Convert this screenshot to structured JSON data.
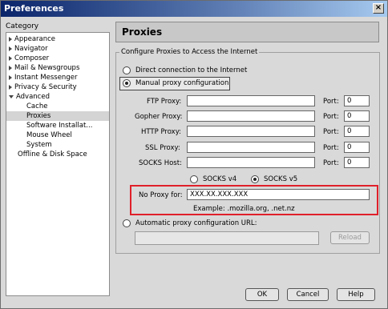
{
  "window": {
    "title": "Preferences",
    "close_glyph": "×"
  },
  "sidebar": {
    "label": "Category",
    "items": [
      {
        "label": "Appearance",
        "expander": "right"
      },
      {
        "label": "Navigator",
        "expander": "right"
      },
      {
        "label": "Composer",
        "expander": "right"
      },
      {
        "label": "Mail & Newsgroups",
        "expander": "right"
      },
      {
        "label": "Instant Messenger",
        "expander": "right"
      },
      {
        "label": "Privacy & Security",
        "expander": "right"
      },
      {
        "label": "Advanced",
        "expander": "down"
      },
      {
        "label": "Cache",
        "expander": ""
      },
      {
        "label": "Proxies",
        "expander": "",
        "selected": true
      },
      {
        "label": "Software Installat...",
        "expander": ""
      },
      {
        "label": "Mouse Wheel",
        "expander": ""
      },
      {
        "label": "System",
        "expander": ""
      },
      {
        "label": "Offline & Disk Space",
        "expander": ""
      }
    ]
  },
  "panel": {
    "title": "Proxies",
    "group_label": "Configure Proxies to Access the Internet",
    "direct_label": "Direct connection to the Internet",
    "manual_label": "Manual proxy configuration",
    "port_label": "Port:",
    "proxies": [
      {
        "label": "FTP Proxy:",
        "host": "",
        "port": "0"
      },
      {
        "label": "Gopher Proxy:",
        "host": "",
        "port": "0"
      },
      {
        "label": "HTTP Proxy:",
        "host": "",
        "port": "0"
      },
      {
        "label": "SSL Proxy:",
        "host": "",
        "port": "0"
      },
      {
        "label": "SOCKS Host:",
        "host": "",
        "port": "0"
      }
    ],
    "socks_v4": "SOCKS v4",
    "socks_v5": "SOCKS v5",
    "no_proxy_label": "No Proxy for:",
    "no_proxy_value": "XXX.XX.XXX.XXX",
    "example": "Example: .mozilla.org, .net.nz",
    "auto_label": "Automatic proxy configuration URL:",
    "auto_url": "",
    "reload": "Reload"
  },
  "buttons": {
    "ok": "OK",
    "cancel": "Cancel",
    "help": "Help"
  },
  "colors": {
    "highlight": "#e0202a",
    "titlebar": "#0a246a"
  }
}
